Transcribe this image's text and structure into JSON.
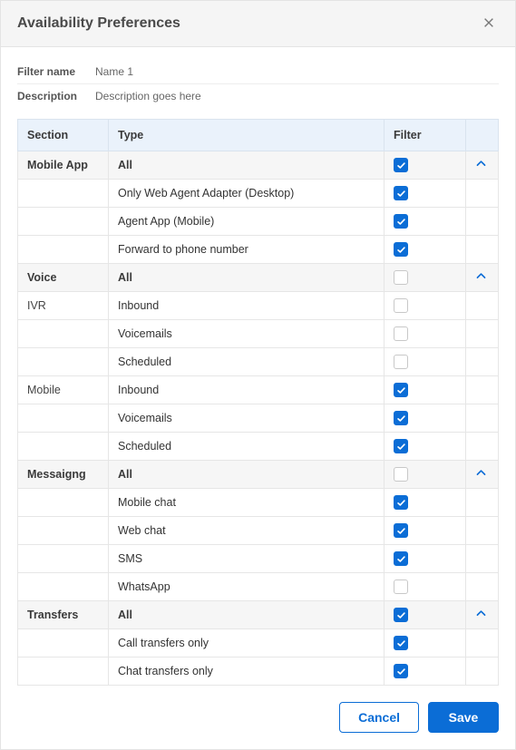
{
  "dialog": {
    "title": "Availability Preferences",
    "close_icon": "close-icon"
  },
  "meta": {
    "filter_name_label": "Filter name",
    "filter_name_value": "Name 1",
    "description_label": "Description",
    "description_value": "Description goes here"
  },
  "table": {
    "headers": {
      "section": "Section",
      "type": "Type",
      "filter": "Filter"
    }
  },
  "sections": [
    {
      "name": "Mobile App",
      "all_label": "All",
      "all_checked": true,
      "expanded": true,
      "rows": [
        {
          "sub": "",
          "type": "Only Web Agent Adapter (Desktop)",
          "checked": true
        },
        {
          "sub": "",
          "type": "Agent App (Mobile)",
          "checked": true
        },
        {
          "sub": "",
          "type": "Forward to phone number",
          "checked": true
        }
      ]
    },
    {
      "name": "Voice",
      "all_label": "All",
      "all_checked": false,
      "expanded": true,
      "rows": [
        {
          "sub": "IVR",
          "type": "Inbound",
          "checked": false
        },
        {
          "sub": "",
          "type": "Voicemails",
          "checked": false
        },
        {
          "sub": "",
          "type": "Scheduled",
          "checked": false
        },
        {
          "sub": "Mobile",
          "type": "Inbound",
          "checked": true
        },
        {
          "sub": "",
          "type": "Voicemails",
          "checked": true
        },
        {
          "sub": "",
          "type": "Scheduled",
          "checked": true
        }
      ]
    },
    {
      "name": "Messaigng",
      "all_label": "All",
      "all_checked": false,
      "expanded": true,
      "rows": [
        {
          "sub": "",
          "type": "Mobile chat",
          "checked": true
        },
        {
          "sub": "",
          "type": "Web chat",
          "checked": true
        },
        {
          "sub": "",
          "type": "SMS",
          "checked": true
        },
        {
          "sub": "",
          "type": "WhatsApp",
          "checked": false
        }
      ]
    },
    {
      "name": "Transfers",
      "all_label": "All",
      "all_checked": true,
      "expanded": true,
      "rows": [
        {
          "sub": "",
          "type": "Call transfers only",
          "checked": true
        },
        {
          "sub": "",
          "type": "Chat transfers only",
          "checked": true
        }
      ]
    }
  ],
  "footer": {
    "cancel": "Cancel",
    "save": "Save"
  }
}
